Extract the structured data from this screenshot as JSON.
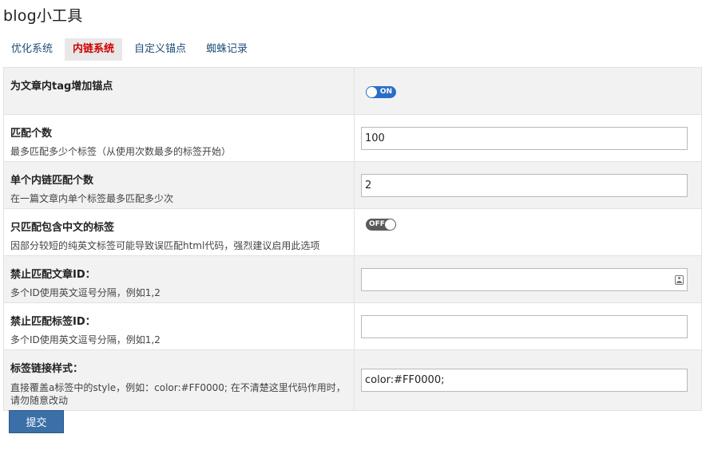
{
  "page": {
    "title": "blog小工具"
  },
  "tabs": [
    {
      "label": "优化系统",
      "active": false
    },
    {
      "label": "内链系统",
      "active": true
    },
    {
      "label": "自定义锚点",
      "active": false
    },
    {
      "label": "蜘蛛记录",
      "active": false
    }
  ],
  "rows": [
    {
      "title": "为文章内tag增加锚点",
      "description": "",
      "control": "toggle",
      "toggle_text": "ON",
      "state": "on"
    },
    {
      "title": "匹配个数",
      "description": "最多匹配多少个标签（从使用次数最多的标签开始）",
      "control": "input",
      "value": "100"
    },
    {
      "title": "单个内链匹配个数",
      "description": "在一篇文章内单个标签最多匹配多少次",
      "control": "input",
      "value": "2"
    },
    {
      "title": "只匹配包含中文的标签",
      "description": "因部分较短的纯英文标签可能导致误匹配html代码，强烈建议启用此选项",
      "control": "toggle",
      "toggle_text": "OFF",
      "state": "off"
    },
    {
      "title": "禁止匹配文章ID：",
      "description": "多个ID使用英文逗号分隔，例如1,2",
      "control": "input",
      "value": ""
    },
    {
      "title": "禁止匹配标签ID：",
      "description": "多个ID使用英文逗号分隔，例如1,2",
      "control": "input",
      "value": ""
    },
    {
      "title": "标签链接样式：",
      "description": "直接覆盖a标签中的style，例如：color:#FF0000; 在不清楚这里代码作用时，请勿随意改动",
      "control": "input",
      "value": "color:#FF0000;"
    }
  ],
  "submit": {
    "label": "提交"
  },
  "colors": {
    "accent": "#3a6fa8",
    "active_tab": "#d00000",
    "toggle_on": "#2a6ec6",
    "toggle_off": "#5a5a5a"
  },
  "icons": {
    "contact_field": "contact-card-icon"
  }
}
